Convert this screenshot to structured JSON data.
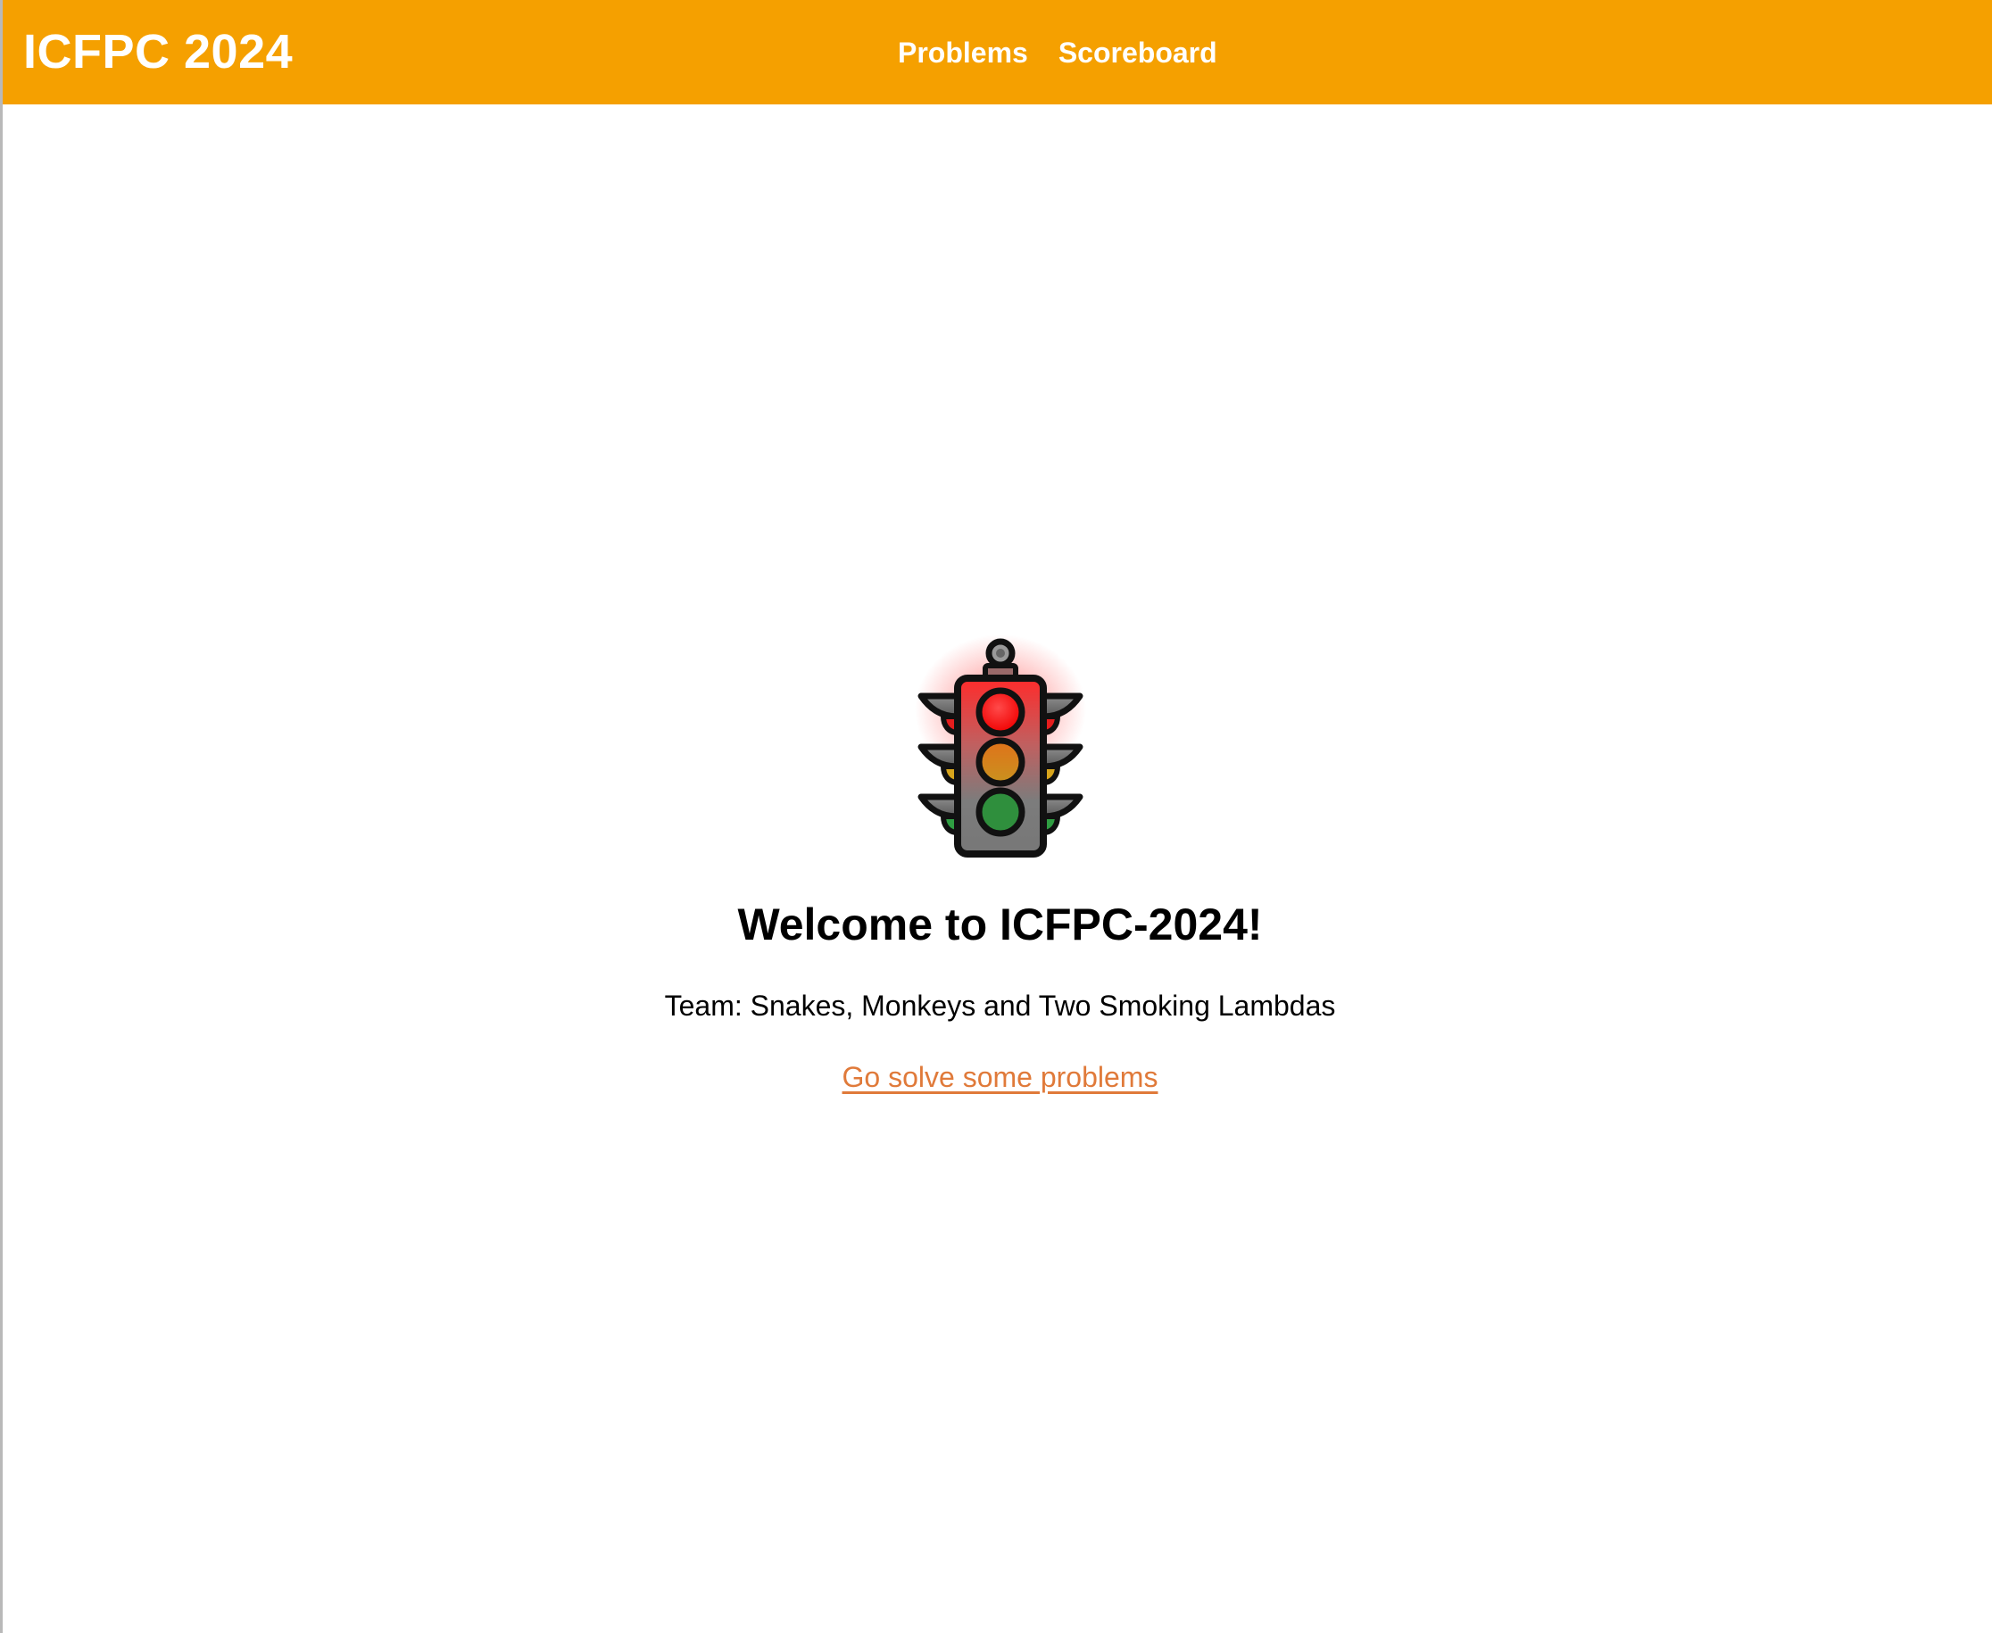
{
  "header": {
    "brand": "ICFPC 2024",
    "nav": [
      {
        "label": "Problems"
      },
      {
        "label": "Scoreboard"
      }
    ],
    "background_color": "#f5a000"
  },
  "main": {
    "logo_icon": "traffic-light-icon",
    "welcome_title": "Welcome to ICFPC-2024!",
    "team_text": "Team: Snakes, Monkeys and Two Smoking Lambdas",
    "cta_link": "Go solve some problems",
    "link_color": "#e07a3a"
  }
}
